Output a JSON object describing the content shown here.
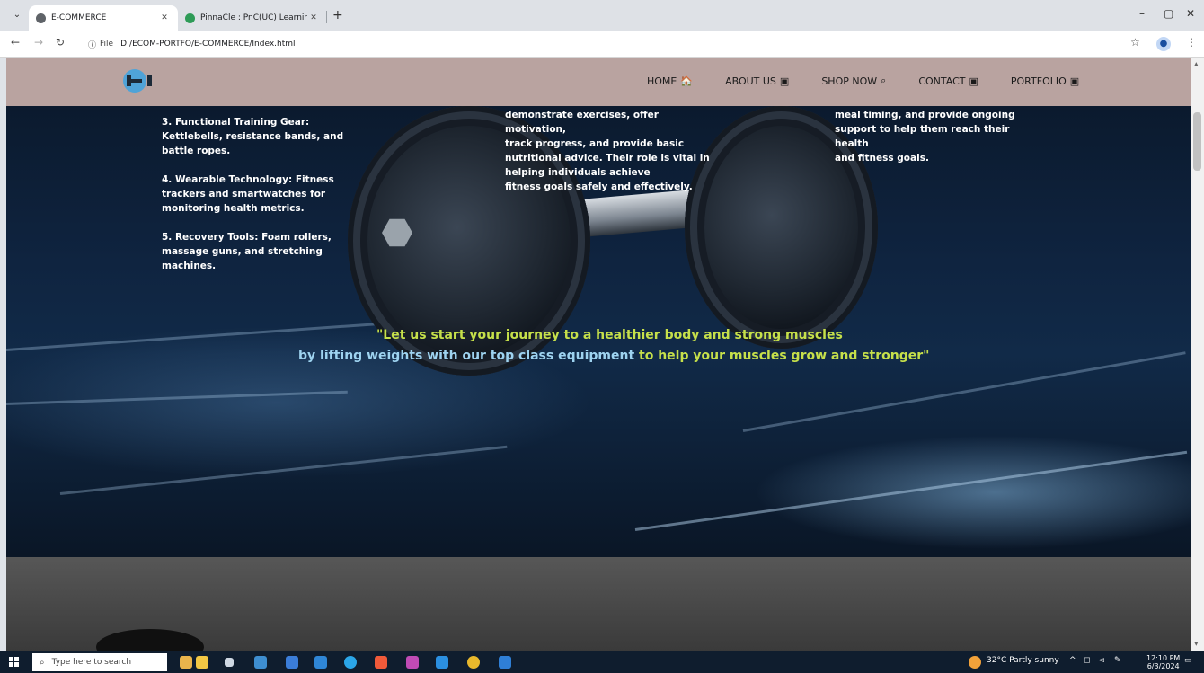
{
  "browser": {
    "tabs": [
      {
        "title": "E-COMMERCE",
        "active": true,
        "favicon": "globe-icon"
      },
      {
        "title": "PinnaCle : PnC(UC) Learning Ma",
        "active": false,
        "favicon": "pinnacle-icon"
      }
    ],
    "new_tab": "+",
    "url_prefix": "File",
    "url": "D:/ECOM-PORTFO/E-COMMERCE/Index.html",
    "controls": {
      "minimize": "–",
      "maximize": "▢",
      "close": "✕"
    }
  },
  "site": {
    "menu": [
      {
        "label": "HOME",
        "icon": "home-icon",
        "glyph": "🏠"
      },
      {
        "label": "ABOUT US",
        "icon": "id-card-icon",
        "glyph": "▣"
      },
      {
        "label": "SHOP NOW",
        "icon": "search-icon",
        "glyph": "⌕"
      },
      {
        "label": "CONTACT",
        "icon": "contact-icon",
        "glyph": "▣"
      },
      {
        "label": "PORTFOLIO",
        "icon": "portfolio-icon",
        "glyph": "▣"
      }
    ],
    "hero": {
      "left_text": "3. Functional Training Gear:\nKettlebells, resistance bands, and\nbattle ropes.\n\n4. Wearable Technology: Fitness\ntrackers and smartwatches for\nmonitoring health metrics.\n\n5. Recovery Tools: Foam rollers,\nmassage guns, and stretching\nmachines.",
      "middle_text": "demonstrate exercises, offer\nmotivation,\ntrack progress, and provide basic\nnutritional advice. Their role is vital in\nhelping individuals achieve\nfitness goals safely and effectively.",
      "right_text": "meal timing, and provide ongoing\nsupport to help them reach their\nhealth\nand fitness goals.",
      "quote_line1": "\"Let us start your journey to a healthier body and strong muscles",
      "quote_line2_a": "by lifting weights with our top class equipment",
      "quote_line2_b": " to help your muscles grow and stronger\""
    }
  },
  "taskbar": {
    "search_placeholder": "Type here to search",
    "weather": "32°C  Partly sunny",
    "time": "12:10 PM",
    "date": "6/3/2024"
  },
  "colors": {
    "header_bg": "#b9a3a0",
    "quote_green": "#c6e04a",
    "quote_blue": "#9ed3f0",
    "taskbar_bg": "#0f1d2e"
  }
}
